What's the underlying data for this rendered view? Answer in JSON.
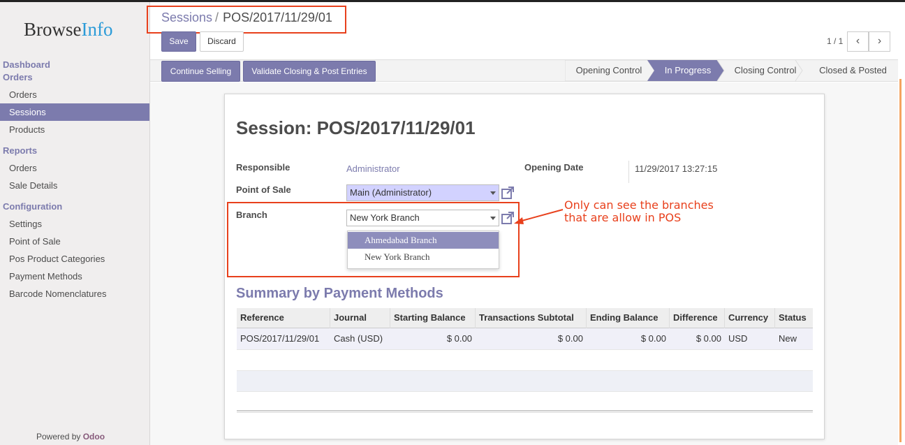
{
  "brand": {
    "name_part1": "Browse",
    "name_part2": "Info"
  },
  "sidebar": {
    "sections": [
      {
        "head1": "Dashboard",
        "head2": "Orders",
        "items": [
          "Orders",
          "Sessions",
          "Products"
        ]
      },
      {
        "head": "Reports",
        "items": [
          "Orders",
          "Sale Details"
        ]
      },
      {
        "head": "Configuration",
        "items": [
          "Settings",
          "Point of Sale",
          "Pos Product Categories",
          "Payment Methods",
          "Barcode Nomenclatures"
        ]
      }
    ],
    "active_item": "Sessions",
    "powered_by": "Powered by",
    "powered_brand": "Odoo"
  },
  "breadcrumb": {
    "parent": "Sessions",
    "separator": "/",
    "current": "POS/2017/11/29/01"
  },
  "toolbar": {
    "save_label": "Save",
    "discard_label": "Discard"
  },
  "pager": {
    "value": "1 / 1",
    "prev": "‹",
    "next": "›"
  },
  "statusbar": {
    "buttons": [
      "Continue Selling",
      "Validate Closing & Post Entries"
    ],
    "stages": [
      "Opening Control",
      "In Progress",
      "Closing Control",
      "Closed & Posted"
    ],
    "active_stage": "In Progress"
  },
  "form": {
    "title": "Session: POS/2017/11/29/01",
    "responsible_label": "Responsible",
    "responsible_value": "Administrator",
    "opening_date_label": "Opening Date",
    "opening_date_value": "11/29/2017 13:27:15",
    "pos_label": "Point of Sale",
    "pos_value": "Main (Administrator)",
    "branch_label": "Branch",
    "branch_value": "New York Branch",
    "branch_options": [
      "Ahmedabad Branch",
      "New York Branch"
    ],
    "highlighted_option": "Ahmedabad Branch"
  },
  "annotation": {
    "line1": "Only can see the branches",
    "line2": "that are allow in POS",
    "color": "#e8401c"
  },
  "summary": {
    "title": "Summary by Payment Methods",
    "columns": [
      "Reference",
      "Journal",
      "Starting Balance",
      "Transactions Subtotal",
      "Ending Balance",
      "Difference",
      "Currency",
      "Status"
    ],
    "rows": [
      [
        "POS/2017/11/29/01",
        "Cash (USD)",
        "$ 0.00",
        "$ 0.00",
        "$ 0.00",
        "$ 0.00",
        "USD",
        "New"
      ]
    ]
  },
  "colors": {
    "primary": "#7c7bad",
    "annotation": "#e8401c",
    "sidebar_bg": "#f0eeee"
  }
}
